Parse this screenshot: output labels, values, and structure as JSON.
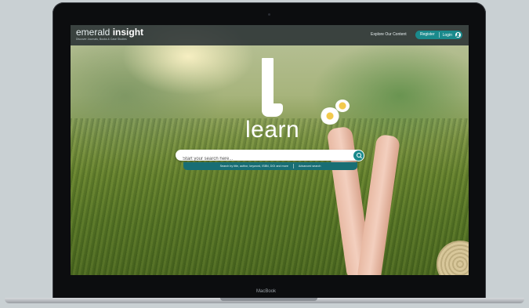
{
  "device": {
    "label": "MacBook"
  },
  "header": {
    "brand_light": "emerald",
    "brand_bold": "insight",
    "brand_subtitle": "Discover Journals, Books & Case Studies",
    "explore_link": "Explore Our Content",
    "register_button": "Register",
    "login_button": "Login"
  },
  "hero": {
    "logo_letter": "l",
    "word": "learn"
  },
  "search": {
    "placeholder": "Start your search here...",
    "helper_text": "Search by title, author, keyword, ISBN, DOI and more",
    "advanced_link": "Advanced search"
  },
  "colors": {
    "accent": "#1a8a8c",
    "accent_dark": "#186e74",
    "header_bg": "#1e262c"
  },
  "icons": [
    "search-icon",
    "user-icon"
  ]
}
